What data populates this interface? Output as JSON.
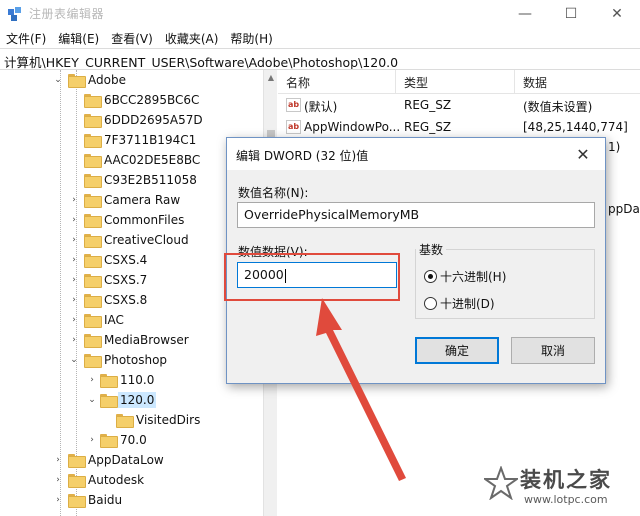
{
  "window": {
    "title": "注册表编辑器",
    "controls": {
      "minimize": "—",
      "maximize": "☐",
      "close": "✕"
    }
  },
  "menu": [
    "文件(F)",
    "编辑(E)",
    "查看(V)",
    "收藏夹(A)",
    "帮助(H)"
  ],
  "address": "计算机\\HKEY_CURRENT_USER\\Software\\Adobe\\Photoshop\\120.0",
  "tree": {
    "items": [
      {
        "label": "Adobe",
        "toggle": "⌄"
      },
      {
        "label": "6BCC2895BC6C",
        "toggle": ""
      },
      {
        "label": "6DDD2695A57D",
        "toggle": ""
      },
      {
        "label": "7F3711B194C1",
        "toggle": ""
      },
      {
        "label": "AAC02DE5E8BC",
        "toggle": ""
      },
      {
        "label": "C93E2B511058",
        "toggle": ""
      },
      {
        "label": "Camera Raw",
        "toggle": "›"
      },
      {
        "label": "CommonFiles",
        "toggle": "›"
      },
      {
        "label": "CreativeCloud",
        "toggle": "›"
      },
      {
        "label": "CSXS.4",
        "toggle": "›"
      },
      {
        "label": "CSXS.7",
        "toggle": "›"
      },
      {
        "label": "CSXS.8",
        "toggle": "›"
      },
      {
        "label": "IAC",
        "toggle": "›"
      },
      {
        "label": "MediaBrowser",
        "toggle": "›"
      },
      {
        "label": "Photoshop",
        "toggle": "⌄"
      },
      {
        "label": "110.0",
        "toggle": "›"
      },
      {
        "label": "120.0",
        "toggle": "⌄"
      },
      {
        "label": "VisitedDirs",
        "toggle": ""
      },
      {
        "label": "70.0",
        "toggle": "›"
      },
      {
        "label": "AppDataLow",
        "toggle": "›"
      },
      {
        "label": "Autodesk",
        "toggle": "›"
      },
      {
        "label": "Baidu",
        "toggle": "›"
      }
    ]
  },
  "values_pane": {
    "headers": {
      "name": "名称",
      "type": "类型",
      "data": "数据"
    },
    "rows": [
      {
        "name": "(默认)",
        "type": "REG_SZ",
        "data": "(数值未设置)"
      },
      {
        "name": "AppWindowPo...",
        "type": "REG_SZ",
        "data": "[48,25,1440,774]"
      }
    ],
    "partial": {
      "p1": "1)",
      "p2": "ppDat"
    },
    "icon_label": "ab"
  },
  "dialog": {
    "title": "编辑 DWORD (32 位)值",
    "close": "✕",
    "name_label": "数值名称(N):",
    "name_value": "OverridePhysicalMemoryMB",
    "data_label": "数值数据(V):",
    "data_value": "20000",
    "base_label": "基数",
    "radio_hex": "十六进制(H)",
    "radio_dec": "十进制(D)",
    "selected_base": "hex",
    "ok": "确定",
    "cancel": "取消"
  },
  "annotation": {
    "color": "#e04a3c"
  },
  "watermark": {
    "title": "装机之家",
    "url": "www.lotpc.com"
  }
}
